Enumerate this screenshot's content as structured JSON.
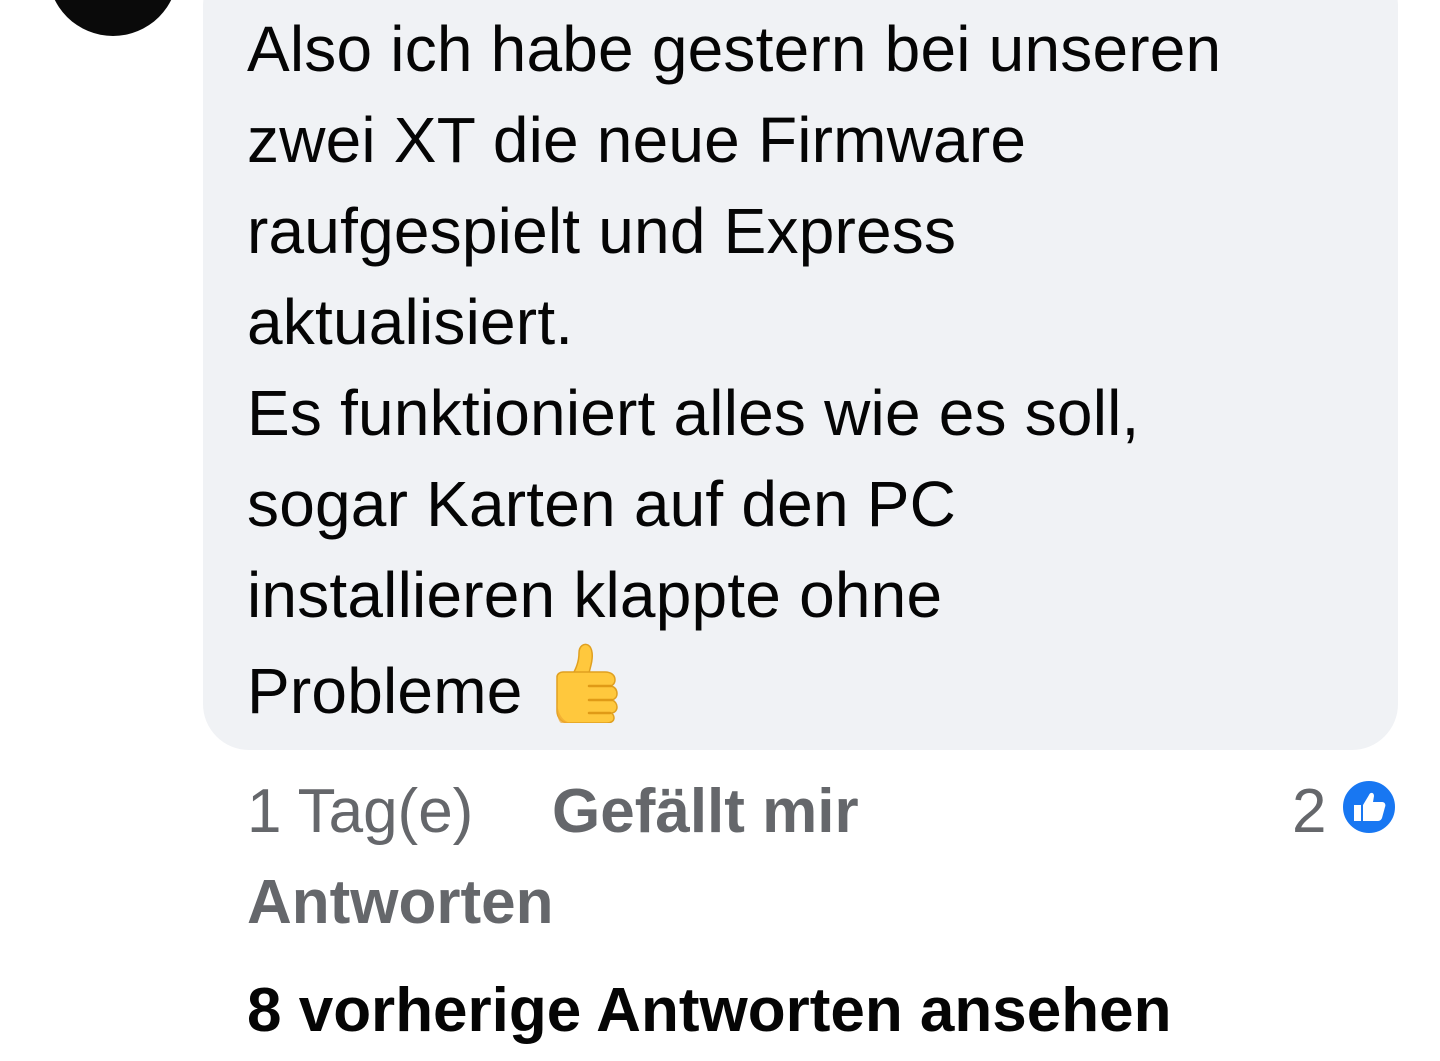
{
  "comment": {
    "lines": [
      "Also ich habe gestern bei unseren",
      "zwei XT die neue Firmware",
      "raufgespielt und Express",
      "aktualisiert.",
      "Es funktioniert alles wie es soll,",
      "sogar Karten auf den PC",
      "installieren klappte ohne",
      "Probleme"
    ],
    "emoji": "thumbs-up-emoji"
  },
  "meta": {
    "time": "1 Tag(e)",
    "like_label": "Gefällt mir",
    "reply_label": "Antworten",
    "reaction_count": "2",
    "reaction_icon": "like-reaction-icon"
  },
  "replies": {
    "view_previous_label": "8 vorherige Antworten ansehen"
  },
  "colors": {
    "bubble_bg": "#f0f2f5",
    "text_primary": "#050505",
    "text_secondary": "#65676b",
    "like_blue": "#1877f2"
  }
}
